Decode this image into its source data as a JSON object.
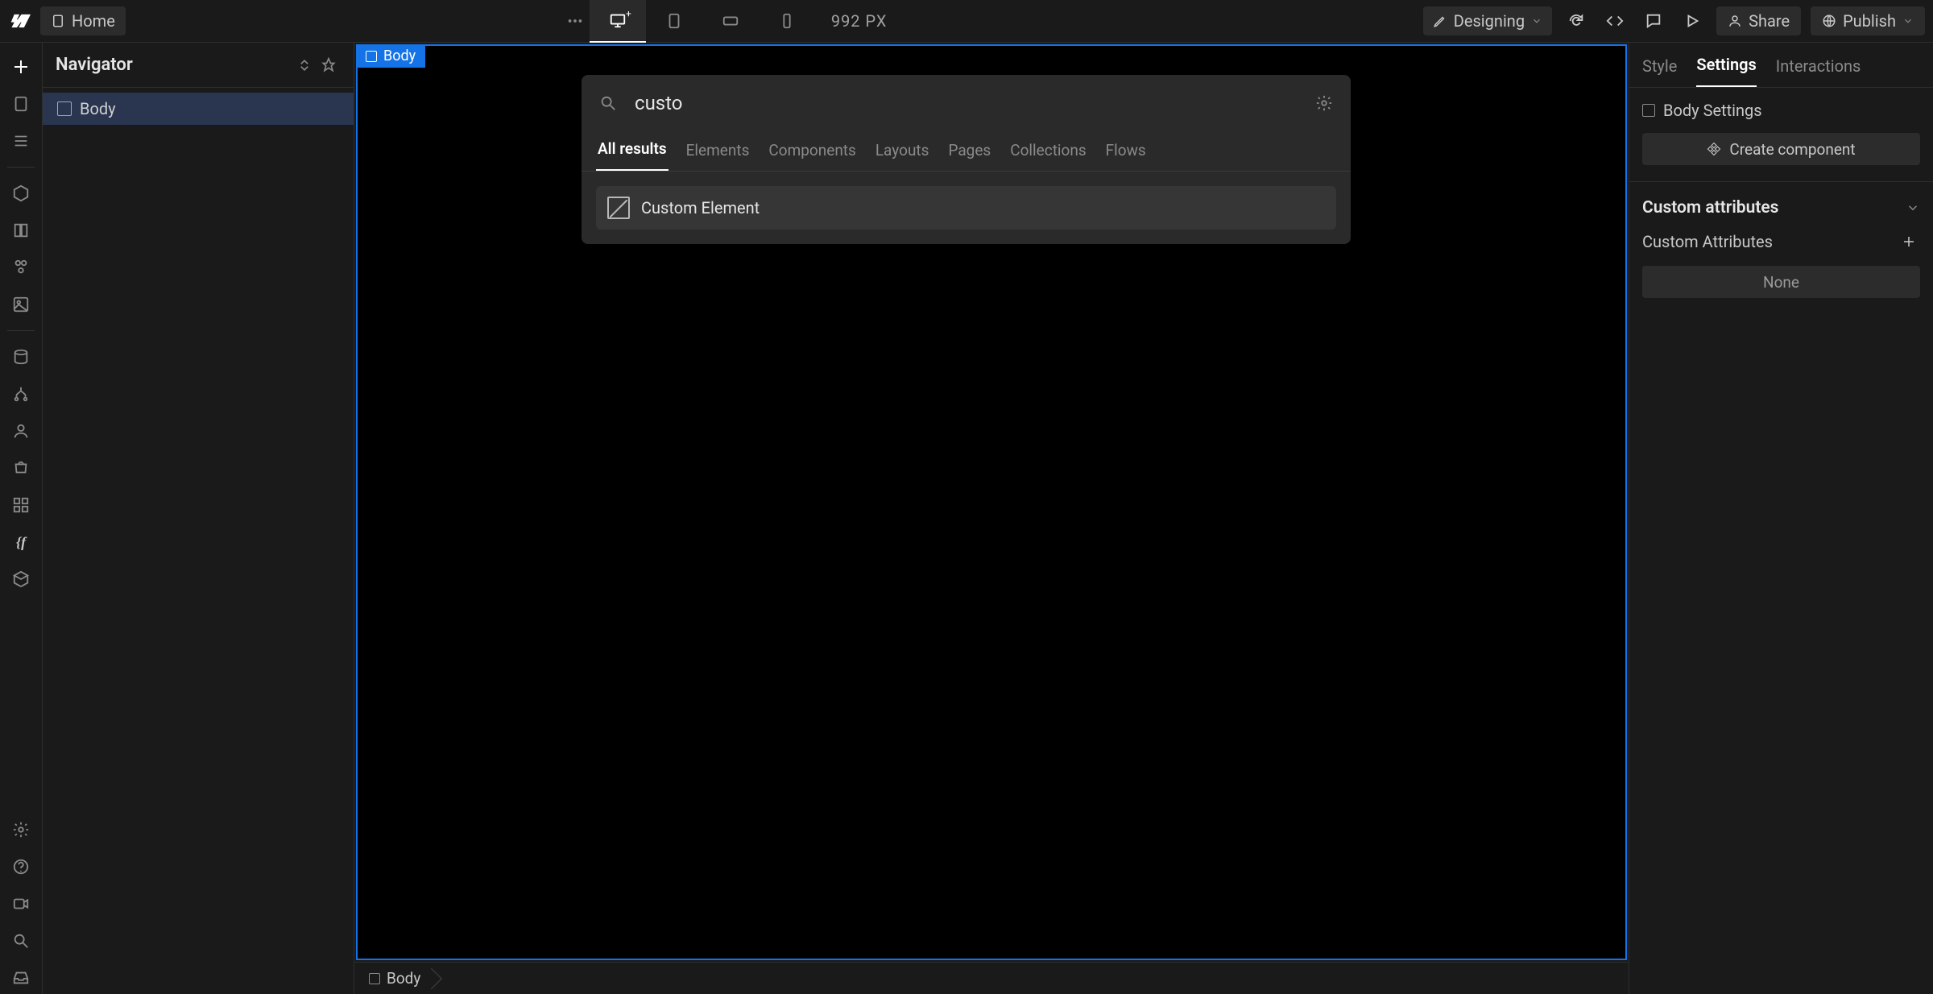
{
  "topbar": {
    "home_label": "Home",
    "px_readout": "992 PX",
    "designing_label": "Designing",
    "share_label": "Share",
    "publish_label": "Publish"
  },
  "navigator": {
    "title": "Navigator",
    "items": [
      {
        "label": "Body"
      }
    ]
  },
  "canvas": {
    "body_tag": "Body",
    "breadcrumb": "Body"
  },
  "quickfind": {
    "value": "custo",
    "placeholder": "",
    "tabs": [
      "All results",
      "Elements",
      "Components",
      "Layouts",
      "Pages",
      "Collections",
      "Flows"
    ],
    "active_tab": 0,
    "results": [
      {
        "label": "Custom Element"
      }
    ]
  },
  "right": {
    "tabs": [
      "Style",
      "Settings",
      "Interactions"
    ],
    "active_tab": 1,
    "body_settings_label": "Body Settings",
    "create_component_label": "Create component",
    "custom_attr_section": "Custom attributes",
    "custom_attr_sub": "Custom Attributes",
    "none_label": "None"
  },
  "icons": {
    "logo": "webflow-logo",
    "page": "page-icon",
    "dots": "more-horizontal-icon",
    "desktop_plus": "desktop-plus-icon",
    "tablet": "tablet-icon",
    "landscape_phone": "phone-landscape-icon",
    "phone": "phone-icon",
    "pencil": "pencil-icon",
    "chevron_down": "chevron-down-icon",
    "refresh": "refresh-icon",
    "code": "code-icon",
    "comment": "comment-icon",
    "play": "play-icon",
    "user": "user-icon",
    "globe": "globe-icon"
  }
}
